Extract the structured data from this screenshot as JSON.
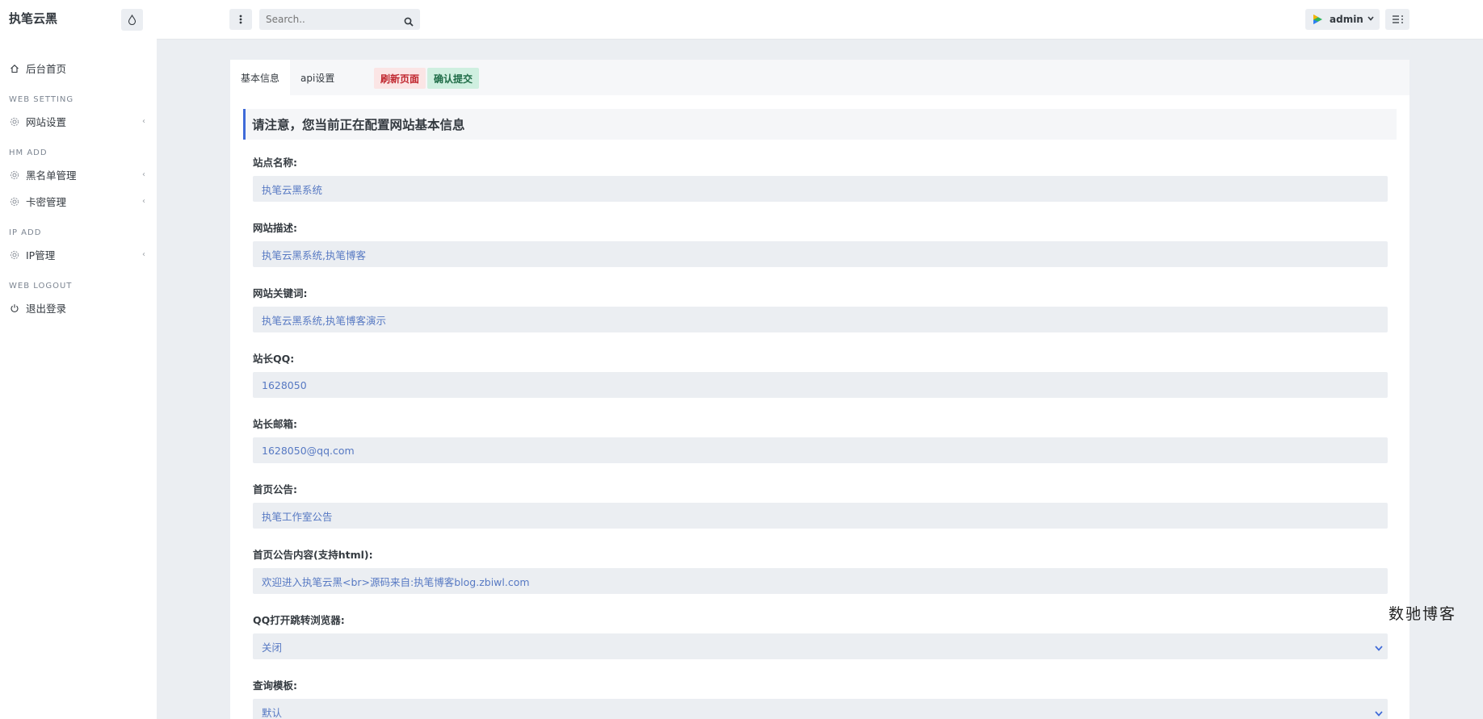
{
  "brand": "执笔云黑",
  "search": {
    "placeholder": "Search.."
  },
  "user": {
    "name": "admin"
  },
  "sidebar": {
    "home": "后台首页",
    "sections": [
      {
        "heading": "WEB SETTING",
        "items": [
          "网站设置"
        ]
      },
      {
        "heading": "HM ADD",
        "items": [
          "黑名单管理",
          "卡密管理"
        ]
      },
      {
        "heading": "IP ADD",
        "items": [
          "IP管理"
        ]
      },
      {
        "heading": "WEB LOGOUT",
        "items": [
          "退出登录"
        ]
      }
    ]
  },
  "tabs": [
    "基本信息",
    "api设置"
  ],
  "buttons": {
    "refresh": "刷新页面",
    "submit": "确认提交"
  },
  "notice": "请注意，您当前正在配置网站基本信息",
  "form": [
    {
      "label": "站点名称:",
      "value": "执笔云黑系统"
    },
    {
      "label": "网站描述:",
      "value": "执笔云黑系统,执笔博客"
    },
    {
      "label": "网站关键词:",
      "value": "执笔云黑系统,执笔博客演示"
    },
    {
      "label": "站长QQ:",
      "value": "1628050"
    },
    {
      "label": "站长邮箱:",
      "value": "1628050@qq.com"
    },
    {
      "label": "首页公告:",
      "value": "执笔工作室公告"
    },
    {
      "label": "首页公告内容(支持html):",
      "value": "欢迎进入执笔云黑<br>源码来自:执笔博客blog.zbiwl.com"
    },
    {
      "label": "QQ打开跳转浏览器:",
      "value": "关闭"
    },
    {
      "label": "查询模板:",
      "value": "默认"
    }
  ],
  "watermark": "数驰博客",
  "colors": {
    "accent": "#3f6ad8",
    "refresh_bg": "#fbe5e5",
    "submit_bg": "#cfefe0",
    "field_text": "#5779c3"
  }
}
